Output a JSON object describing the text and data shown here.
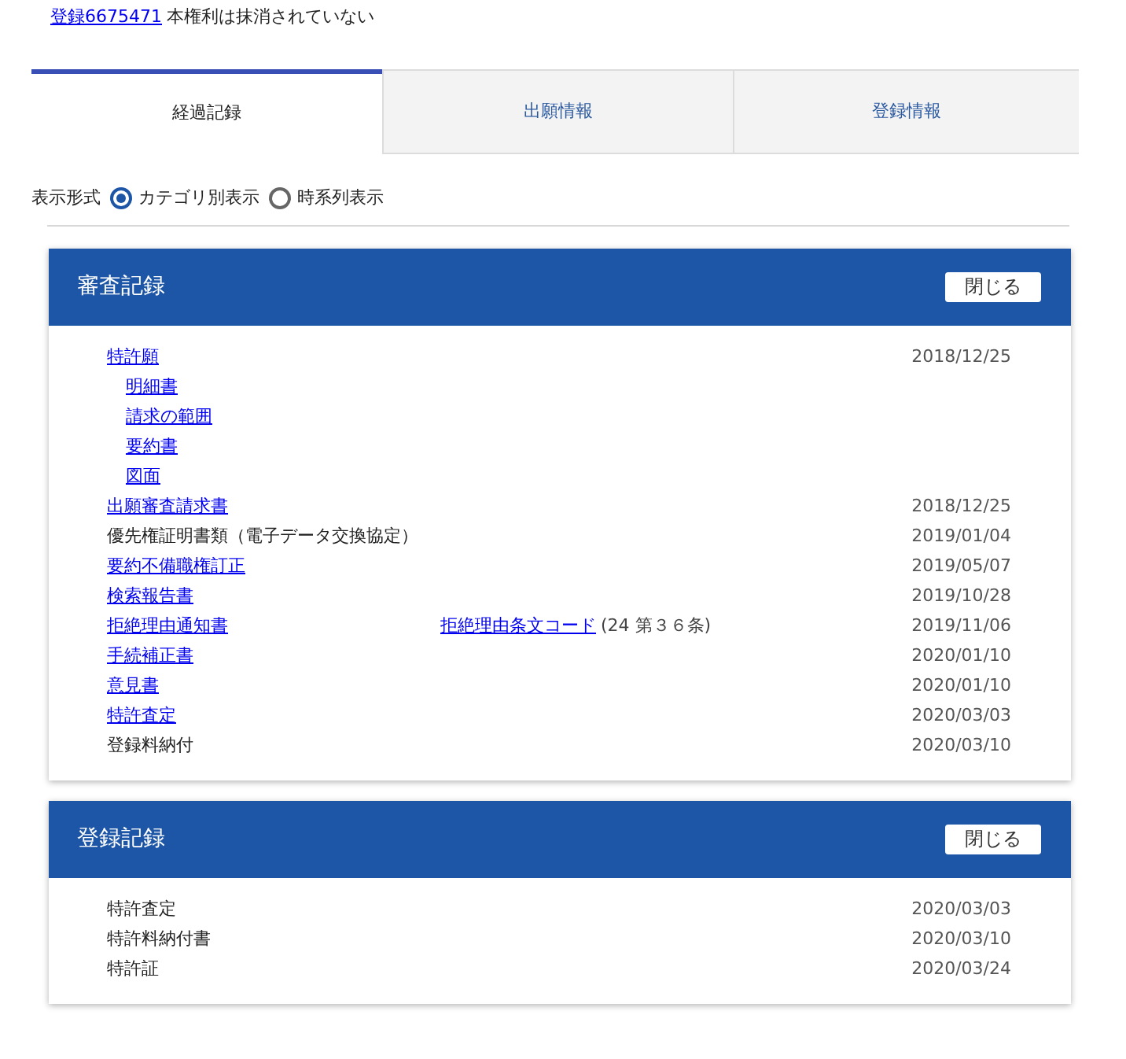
{
  "header": {
    "registration_link": "登録6675471",
    "status": "本権利は抹消されていない"
  },
  "tabs": [
    {
      "label": "経過記録",
      "selected": true
    },
    {
      "label": "出願情報",
      "selected": false
    },
    {
      "label": "登録情報",
      "selected": false
    }
  ],
  "display_format": {
    "label": "表示形式",
    "options": [
      {
        "label": "カテゴリ別表示",
        "selected": true
      },
      {
        "label": "時系列表示",
        "selected": false
      }
    ]
  },
  "sections": [
    {
      "title": "審査記録",
      "button": "閉じる",
      "rows": [
        {
          "label": "特許願",
          "kind": "link",
          "date": "2018/12/25",
          "children": [
            {
              "label": "明細書",
              "kind": "link"
            },
            {
              "label": "請求の範囲",
              "kind": "link"
            },
            {
              "label": "要約書",
              "kind": "link"
            },
            {
              "label": "図面",
              "kind": "link"
            }
          ]
        },
        {
          "label": "出願審査請求書",
          "kind": "link",
          "date": "2018/12/25"
        },
        {
          "label": "優先権証明書類（電子データ交換協定）",
          "kind": "text",
          "date": "2019/01/04"
        },
        {
          "label": "要約不備職権訂正",
          "kind": "link",
          "date": "2019/05/07"
        },
        {
          "label": "検索報告書",
          "kind": "link",
          "date": "2019/10/28"
        },
        {
          "label": "拒絶理由通知書",
          "kind": "link",
          "date": "2019/11/06",
          "note": {
            "link": "拒絶理由条文コード",
            "text": "(24 第３６条)"
          }
        },
        {
          "label": "手続補正書",
          "kind": "link",
          "date": "2020/01/10"
        },
        {
          "label": "意見書",
          "kind": "link",
          "date": "2020/01/10"
        },
        {
          "label": "特許査定",
          "kind": "link",
          "date": "2020/03/03"
        },
        {
          "label": "登録料納付",
          "kind": "text",
          "date": "2020/03/10"
        }
      ]
    },
    {
      "title": "登録記録",
      "button": "閉じる",
      "rows": [
        {
          "label": "特許査定",
          "kind": "text",
          "date": "2020/03/03"
        },
        {
          "label": "特許料納付書",
          "kind": "text",
          "date": "2020/03/10"
        },
        {
          "label": "特許証",
          "kind": "text",
          "date": "2020/03/24"
        }
      ]
    }
  ]
}
